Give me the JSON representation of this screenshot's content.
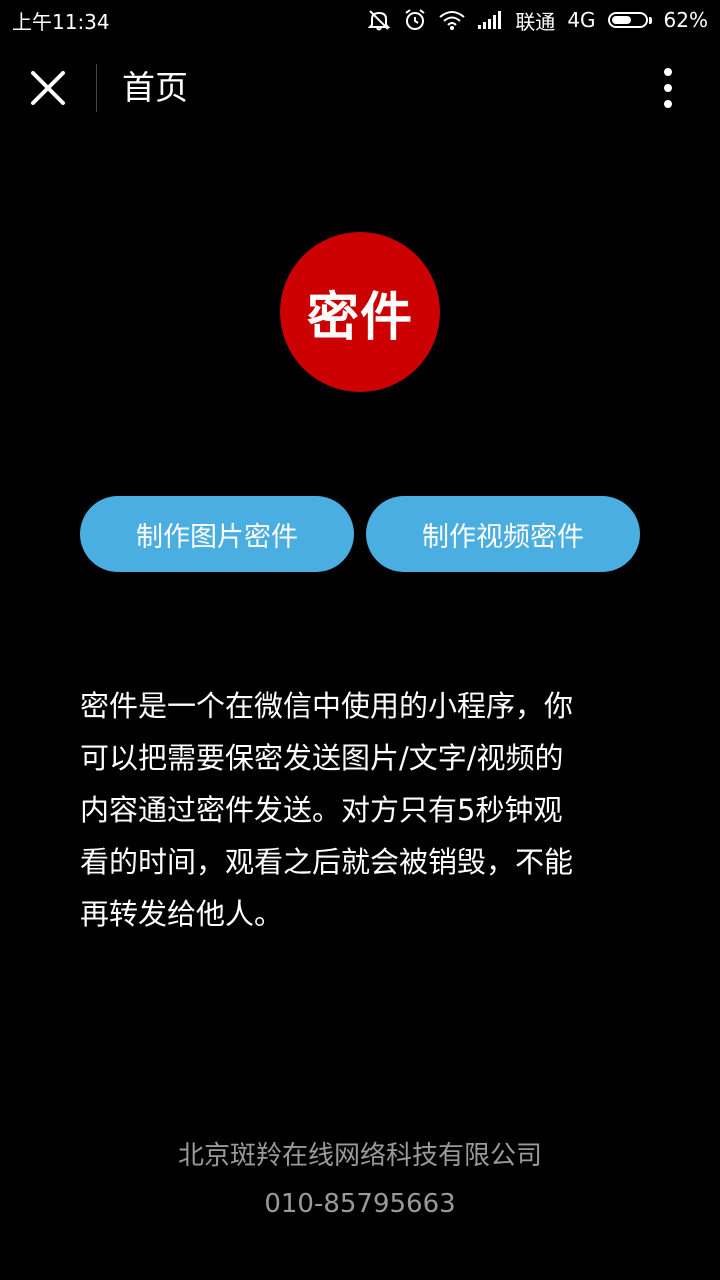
{
  "status_bar": {
    "time": "上午11:34",
    "carrier": "联通",
    "network": "4G",
    "battery_text": "62%",
    "battery_level": 0.62,
    "icons": [
      "mute-icon",
      "alarm-icon",
      "wifi-icon",
      "signal-icon",
      "battery-icon"
    ]
  },
  "nav": {
    "title": "首页",
    "close_icon": "close-icon",
    "more_icon": "more-vertical-icon"
  },
  "logo": {
    "text": "密件",
    "color": "#cc0000"
  },
  "actions": {
    "make_image_label": "制作图片密件",
    "make_video_label": "制作视频密件",
    "color": "#4aaee0"
  },
  "description": {
    "lines": [
      "密件是一个在微信中使用的小程序，你",
      "可以把需要保密发送图片/文字/视频的",
      "内容通过密件发送。对方只有5秒钟观",
      "看的时间，观看之后就会被销毁，不能",
      "再转发给他人。"
    ]
  },
  "footer": {
    "company": "北京斑羚在线网络科技有限公司",
    "phone": "010-85795663"
  }
}
